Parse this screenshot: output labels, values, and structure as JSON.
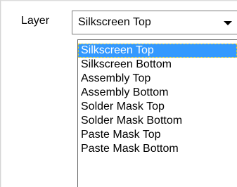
{
  "layer_field": {
    "label": "Layer",
    "selected_value": "Silkscreen Top",
    "dropdown_arrow_icon": "chevron-down-icon"
  },
  "dropdown": {
    "options": [
      "Silkscreen Top",
      "Silkscreen Bottom",
      "Assembly Top",
      "Assembly Bottom",
      "Solder Mask Top",
      "Solder Mask Bottom",
      "Paste Mask Top",
      "Paste Mask Bottom"
    ],
    "highlighted_index": 0,
    "highlight_color": "#3399ff"
  }
}
